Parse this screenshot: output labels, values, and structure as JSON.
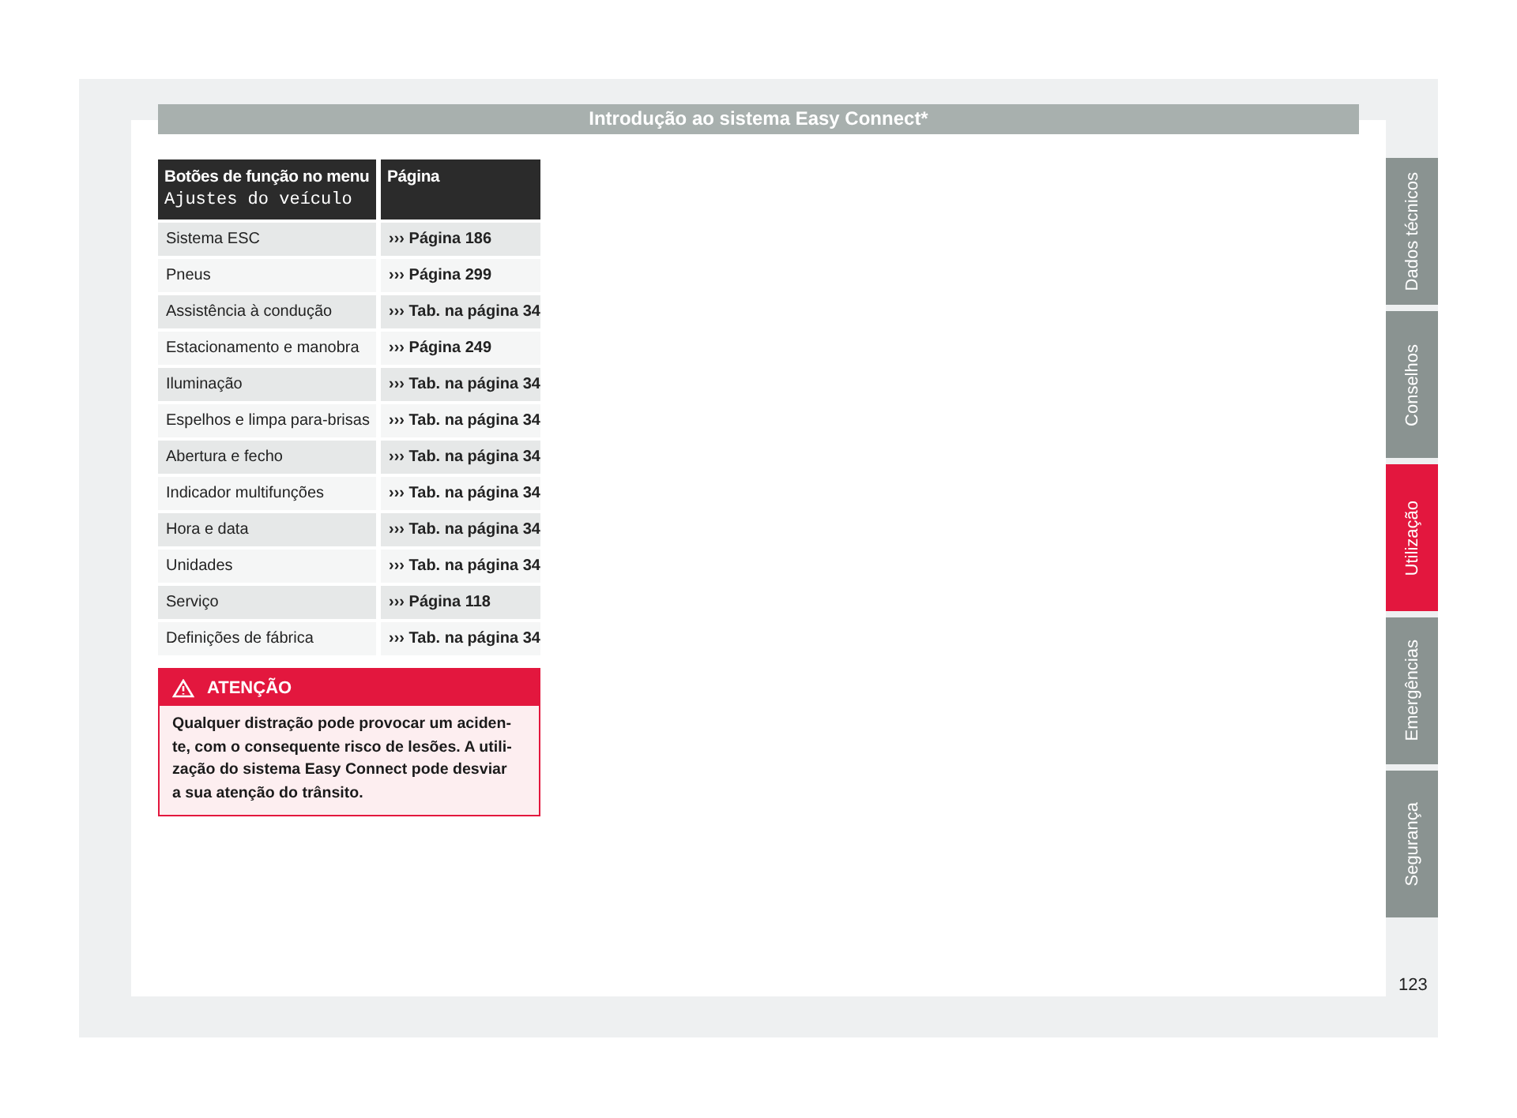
{
  "header": {
    "title": "Introdução ao sistema Easy Connect*"
  },
  "table": {
    "columns": [
      {
        "label": "Botões de função no menu",
        "sublabel": "Ajustes do veículo"
      },
      {
        "label": "Página"
      }
    ],
    "rows": [
      {
        "function": "Sistema ESC",
        "reference": "››› Página 186"
      },
      {
        "function": "Pneus",
        "reference": "››› Página 299"
      },
      {
        "function": "Assistência à condução",
        "reference": "››› Tab. na página 34"
      },
      {
        "function": "Estacionamento e manobra",
        "reference": "››› Página 249"
      },
      {
        "function": "Iluminação",
        "reference": "››› Tab. na página 34"
      },
      {
        "function": "Espelhos e limpa para-brisas",
        "reference": "››› Tab. na página 34"
      },
      {
        "function": "Abertura e fecho",
        "reference": "››› Tab. na página 34"
      },
      {
        "function": "Indicador multifunções",
        "reference": "››› Tab. na página 34"
      },
      {
        "function": "Hora e data",
        "reference": "››› Tab. na página 34"
      },
      {
        "function": "Unidades",
        "reference": "››› Tab. na página 34"
      },
      {
        "function": "Serviço",
        "reference": "››› Página 118"
      },
      {
        "function": "Definições de fábrica",
        "reference": "››› Tab. na página 34"
      }
    ]
  },
  "warning": {
    "title": "ATENÇÃO",
    "lines": [
      "Qualquer distração pode provocar um aciden-",
      "te, com o consequente risco de lesões. A utili-",
      "zação do sistema Easy Connect pode desviar",
      "a sua atenção do trânsito."
    ]
  },
  "side_tabs": [
    {
      "label": "Dados técnicos",
      "selected": false
    },
    {
      "label": "Conselhos",
      "selected": false
    },
    {
      "label": "Utilização",
      "selected": true
    },
    {
      "label": "Emergências",
      "selected": false
    },
    {
      "label": "Segurança",
      "selected": false
    }
  ],
  "page_number": "123"
}
